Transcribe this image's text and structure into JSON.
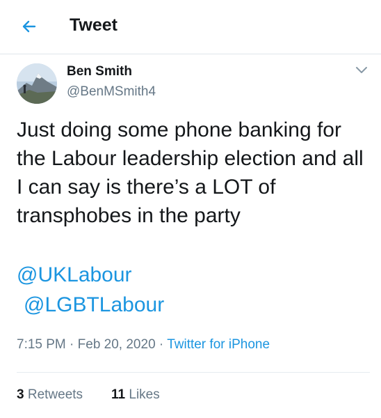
{
  "header": {
    "title": "Tweet",
    "back_icon": "arrow-left-icon"
  },
  "tweet": {
    "author": {
      "display_name": "Ben Smith",
      "handle": "@BenMSmith4",
      "avatar": "mountain-photo-avatar"
    },
    "menu_icon": "chevron-down-icon",
    "text": "Just doing some phone banking for the Labour leadership election and all I can say is there’s a LOT of transphobes in the party",
    "mentions": [
      "@UKLabour",
      "@LGBTLabour"
    ],
    "time": "7:15 PM",
    "date": "Feb 20, 2020",
    "separator": "·",
    "source": "Twitter for iPhone",
    "stats": {
      "retweets_count": "3",
      "retweets_label": "Retweets",
      "likes_count": "11",
      "likes_label": "Likes"
    }
  },
  "colors": {
    "accent": "#1b95e0",
    "secondary_text": "#657786",
    "primary_text": "#14171a",
    "divider": "#e6ecf0"
  }
}
